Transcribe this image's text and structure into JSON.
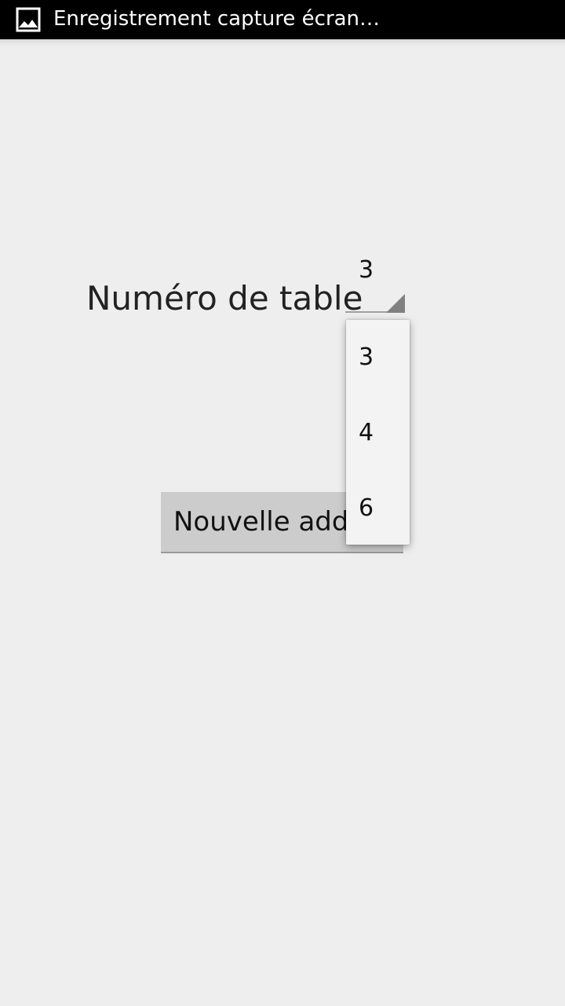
{
  "status_bar": {
    "notification_icon": "image-icon",
    "text": "Enregistrement capture écran…"
  },
  "form": {
    "label": "Numéro de table",
    "spinner": {
      "selected_value": "3",
      "options": [
        "3",
        "4",
        "6"
      ]
    },
    "button_label": "Nouvelle addition"
  },
  "colors": {
    "background": "#eeeeee",
    "status_bar": "#000000",
    "button": "#cccccc"
  }
}
